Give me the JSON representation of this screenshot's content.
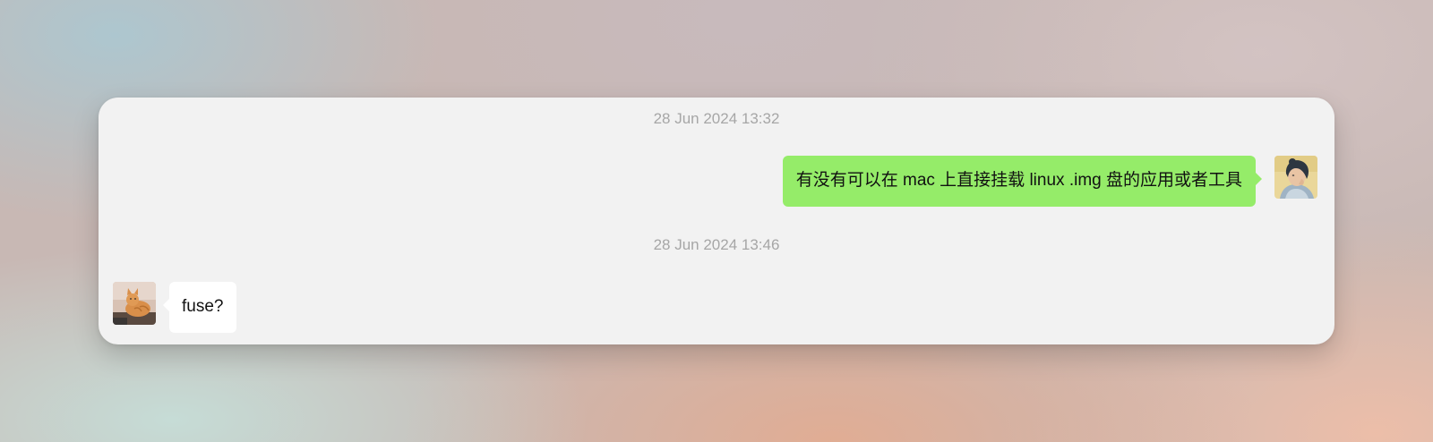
{
  "conversation": {
    "messages": [
      {
        "timestamp": "28 Jun 2024 13:32",
        "sender": "me",
        "avatar_icon": "user-avatar-portrait",
        "bubble_color": "#95ec69",
        "text": "有没有可以在 mac 上直接挂载 linux .img 盘的应用或者工具"
      },
      {
        "timestamp": "28 Jun 2024 13:46",
        "sender": "other",
        "avatar_icon": "contact-avatar-cat",
        "bubble_color": "#ffffff",
        "text": "fuse?"
      }
    ]
  },
  "colors": {
    "card_background": "#f2f2f2",
    "timestamp_text": "#a6a6a6"
  }
}
